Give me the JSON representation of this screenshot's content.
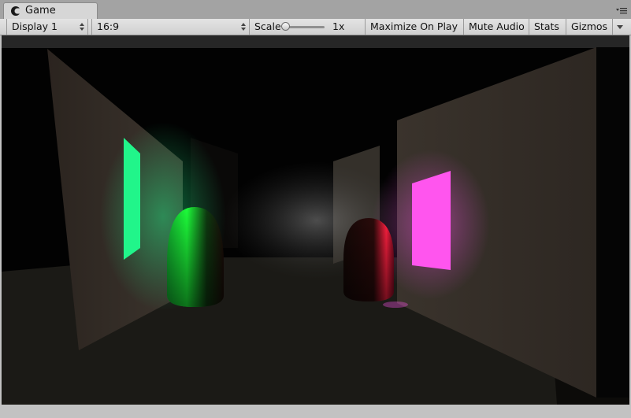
{
  "window": {
    "tab_label": "Game",
    "tab_icon": "game-controller-icon",
    "menu_icon": "panel-menu-icon"
  },
  "toolbar": {
    "display": "Display 1",
    "aspect": "16:9",
    "scale_label": "Scale",
    "scale_value": "1x",
    "scale_level": 0.0,
    "maximize_on_play": "Maximize On Play",
    "mute_audio": "Mute Audio",
    "stats": "Stats",
    "gizmos": "Gizmos"
  },
  "scene": {
    "accent_green": "#21f58a",
    "accent_magenta": "#ff55ee",
    "accent_red": "#ff2040"
  }
}
